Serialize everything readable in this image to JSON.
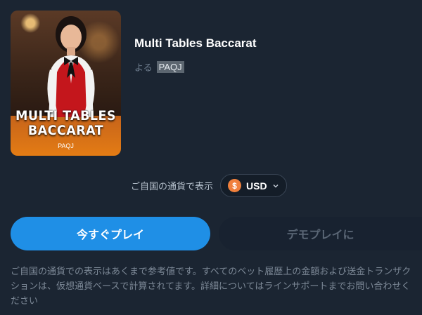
{
  "game": {
    "thumbnail_title": "MULTI TABLES BACCARAT",
    "thumbnail_brand": "PAQJ",
    "title": "Multi Tables Baccarat",
    "by_label": "よる",
    "provider": "PAQJ"
  },
  "currency": {
    "label": "ご自国の通貨で表示",
    "coin_symbol": "$",
    "code": "USD"
  },
  "actions": {
    "play_label": "今すぐプレイ",
    "demo_label": "デモプレイに"
  },
  "disclaimer": "ご自国の通貨での表示はあくまで参考値です。すべてのベット履歴上の金額および送金トランザクションは、仮想通貨ベースで計算されてます。詳細についてはラインサポートまでお問い合わせください",
  "colors": {
    "background": "#1b2532",
    "primary_button": "#1f8fe6",
    "coin": "#f0803c"
  }
}
